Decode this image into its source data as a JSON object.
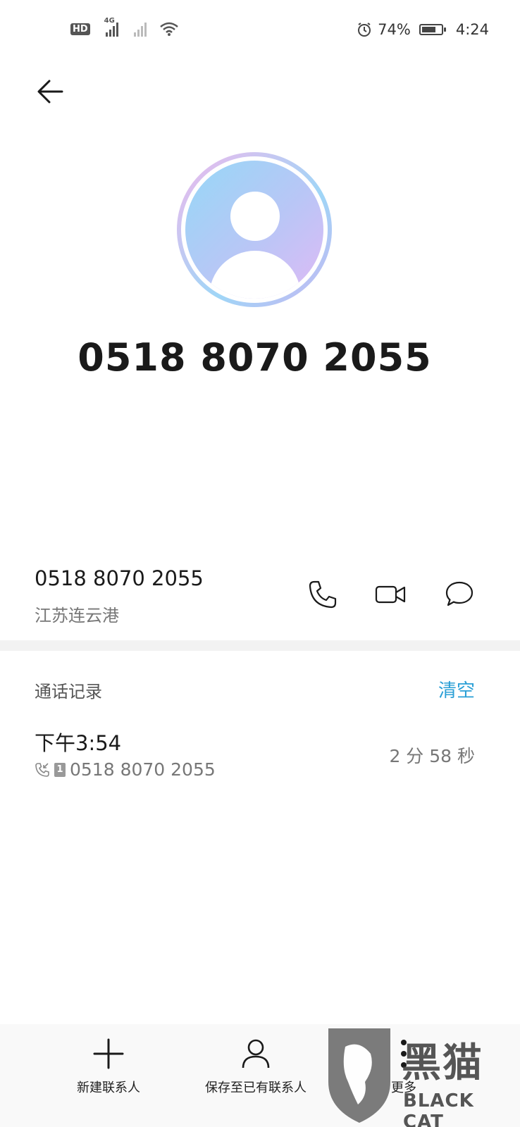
{
  "status_bar": {
    "left_badge": "HD",
    "network_label": "4G",
    "battery_percent": "74%",
    "battery_level": 0.74,
    "time": "4:24"
  },
  "contact": {
    "number_large": "0518 8070 2055",
    "number": "0518 8070 2055",
    "location": "江苏连云港"
  },
  "call_log": {
    "title": "通话记录",
    "clear_label": "清空",
    "entries": [
      {
        "time": "下午3:54",
        "sim": "1",
        "number": "0518 8070 2055",
        "duration": "2 分 58 秒"
      }
    ]
  },
  "bottom_bar": {
    "new_contact": "新建联系人",
    "save_existing": "保存至已有联系人",
    "more": "更多"
  },
  "watermark": {
    "cn": "黑猫",
    "en": "BLACK CAT"
  },
  "colors": {
    "accent": "#2a9fd6",
    "text": "#1a1a1a",
    "secondary": "#777777"
  }
}
